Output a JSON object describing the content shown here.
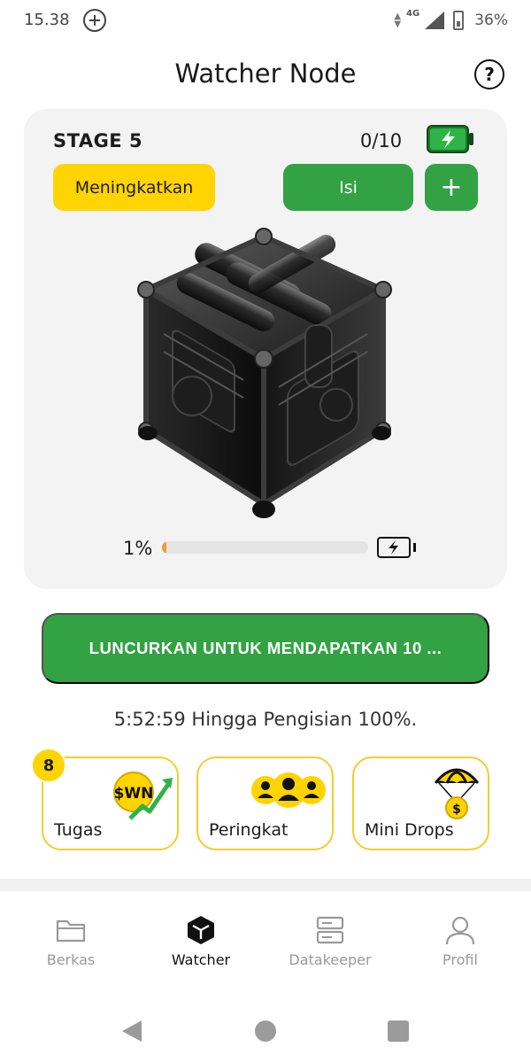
{
  "status_bar": {
    "time": "15.38",
    "network": "4G",
    "battery": "36%",
    "icons": [
      "add-circle-icon",
      "data-arrows-icon",
      "signal-icon",
      "battery-icon"
    ]
  },
  "header": {
    "title": "Watcher Node",
    "help_icon": "help-icon",
    "help_symbol": "?"
  },
  "node_card": {
    "stage": "STAGE 5",
    "charge_count": "0/10",
    "upgrade_label": "Meningkatkan",
    "fill_label": "Isi",
    "add_symbol": "+",
    "progress_label": "1%",
    "progress_value": 0.01,
    "charge_icon": "battery-bolt-icon"
  },
  "launch": {
    "label": "LUNCURKAN UNTUK MENDAPATKAN 10 ..."
  },
  "countdown": "5:52:59 Hingga Pengisian 100%.",
  "features": {
    "tasks": {
      "label": "Tugas",
      "badge": "8",
      "icon": "swn-growth-icon",
      "icon_text": "$WN"
    },
    "rank": {
      "label": "Peringkat",
      "icon": "people-group-icon"
    },
    "drops": {
      "label": "Mini Drops",
      "icon": "parachute-coin-icon",
      "icon_text": "$"
    }
  },
  "bottom_nav": {
    "items": [
      {
        "label": "Berkas",
        "icon": "folder-icon",
        "active": false
      },
      {
        "label": "Watcher",
        "icon": "cube-icon",
        "active": true
      },
      {
        "label": "Datakeeper",
        "icon": "server-icon",
        "active": false
      },
      {
        "label": "Profil",
        "icon": "profile-icon",
        "active": false
      }
    ]
  },
  "colors": {
    "accent_green": "#32a244",
    "accent_yellow": "#ffd400",
    "progress_orange": "#f59a3a",
    "card_border": "#f4cc2e"
  }
}
